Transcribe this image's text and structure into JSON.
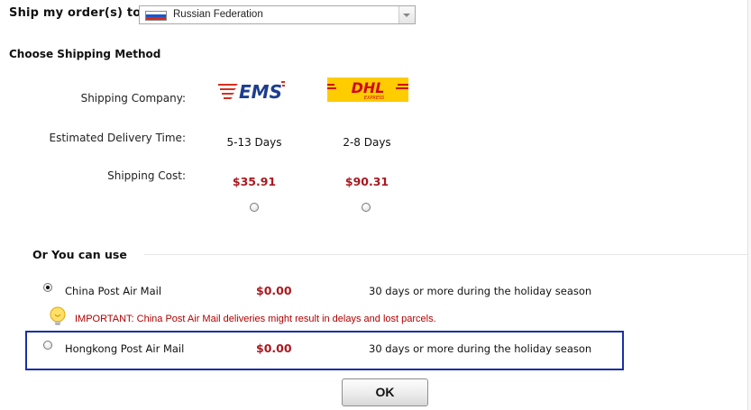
{
  "header": {
    "ship_to_label": "Ship my order(s) to",
    "country": {
      "selected": "Russian Federation",
      "flag_icon": "russia-flag-icon"
    }
  },
  "shipping_method": {
    "title": "Choose Shipping Method",
    "labels": {
      "company": "Shipping Company:",
      "delivery": "Estimated Delivery Time:",
      "cost": "Shipping Cost:"
    },
    "carriers": [
      {
        "logo_text": "EMS",
        "delivery_time": "5-13 Days",
        "cost": "$35.91",
        "selected": false
      },
      {
        "logo_text": "DHL",
        "logo_subtext": "EXPRESS",
        "delivery_time": "2-8 Days",
        "cost": "$90.31",
        "selected": false
      }
    ]
  },
  "alternatives": {
    "title": "Or You can use",
    "options": [
      {
        "name": "China Post Air Mail",
        "price": "$0.00",
        "note": "30 days or more during the holiday season",
        "selected": true
      },
      {
        "name": "Hongkong Post Air Mail",
        "price": "$0.00",
        "note": "30 days or more during the holiday season",
        "selected": false
      }
    ],
    "notice": "IMPORTANT: China Post Air Mail deliveries might result in delays and lost parcels.",
    "notice_icon": "lightbulb-icon"
  },
  "ok_button": "OK",
  "colors": {
    "price": "#a8191f",
    "notice": "#b00000",
    "highlight_border": "#1a2fa6",
    "dhl_yellow": "#ffcc00",
    "dhl_red": "#d40511",
    "ems_red": "#d4301f",
    "ems_blue": "#1d3e8f"
  }
}
